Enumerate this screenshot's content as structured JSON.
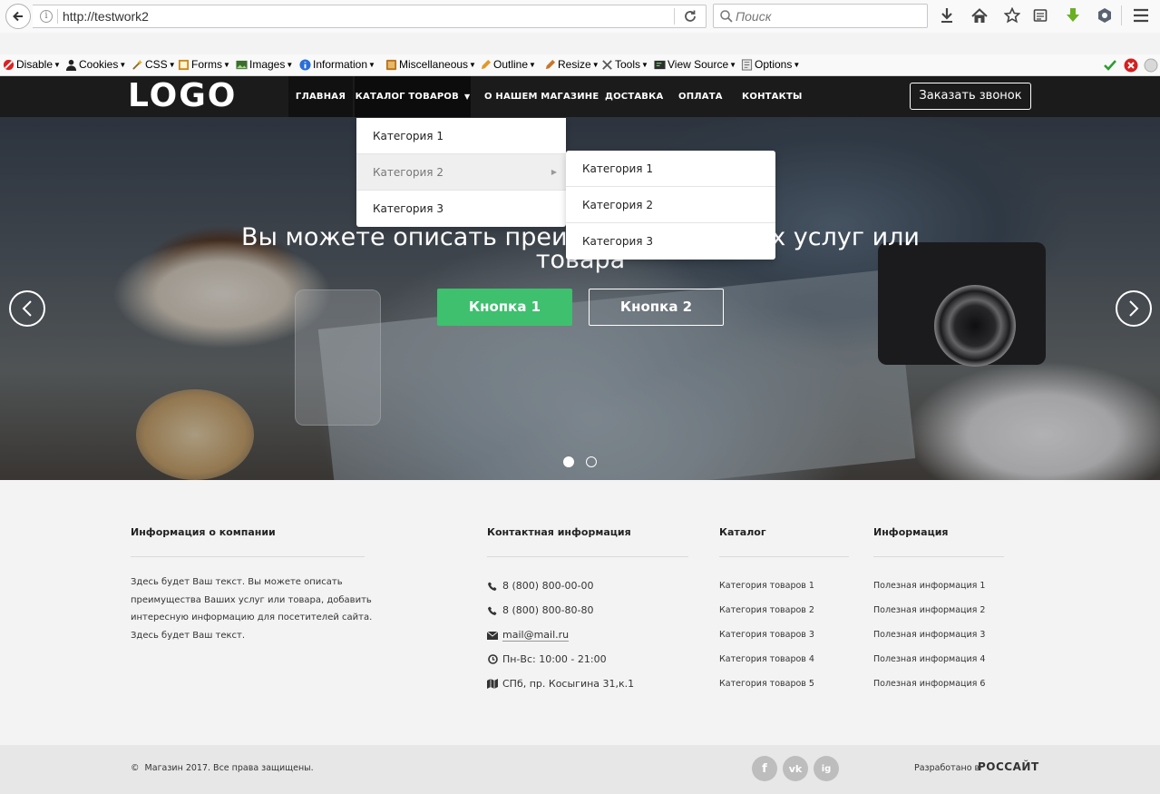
{
  "browser": {
    "url": "http://testwork2",
    "search_placeholder": "Поиск"
  },
  "devtools": {
    "items": [
      "Disable",
      "Cookies",
      "CSS",
      "Forms",
      "Images",
      "Information",
      "Miscellaneous",
      "Outline",
      "Resize",
      "Tools",
      "View Source",
      "Options"
    ]
  },
  "header": {
    "logo": "LOGO",
    "nav": [
      "Главная",
      "Каталог товаров",
      "О нашем магазине",
      "Доставка",
      "Оплата",
      "Контакты"
    ],
    "callback": "Заказать звонок"
  },
  "dropdown": {
    "items": [
      "Категория 1",
      "Категория 2",
      "Категория 3"
    ],
    "submenu": [
      "Категория 1",
      "Категория 2",
      "Категория 3"
    ]
  },
  "hero": {
    "title": "Вы можете описать преимущества ваших услуг или товара",
    "button1": "Кнопка 1",
    "button2": "Кнопка 2",
    "active_slide": 1,
    "slides": 2
  },
  "footer": {
    "about": {
      "title": "Информация о компании",
      "text": "Здесь будет Ваш текст. Вы можете описать преимущества Ваших услуг или товара, добавить интересную информацию для посетителей сайта. Здесь будет Ваш текст."
    },
    "contacts": {
      "title": "Контактная информация",
      "phone1": "8 (800) 800-00-00",
      "phone2": "8 (800) 800-80-80",
      "email": "mail@mail.ru",
      "hours": "Пн-Вс: 10:00 - 21:00",
      "address": "СПб, пр. Косыгина 31,к.1"
    },
    "catalog": {
      "title": "Каталог",
      "items": [
        "Категория товаров 1",
        "Категория товаров 2",
        "Категория товаров 3",
        "Категория товаров 4",
        "Категория товаров 5"
      ]
    },
    "info": {
      "title": "Информация",
      "items": [
        "Полезная информация 1",
        "Полезная информация 2",
        "Полезная информация 3",
        "Полезная информация 4",
        "Полезная информация 6"
      ]
    }
  },
  "bottom": {
    "copyright": "Магазин 2017. Все права защищены.",
    "copyright_symbol": "©",
    "social": [
      "f",
      "vk",
      "ig"
    ],
    "developed_by": "Разработано в",
    "brand": "РОССАЙТ"
  },
  "colors": {
    "header_bg": "#1b1b1b",
    "accent_green": "#3fc06e"
  }
}
